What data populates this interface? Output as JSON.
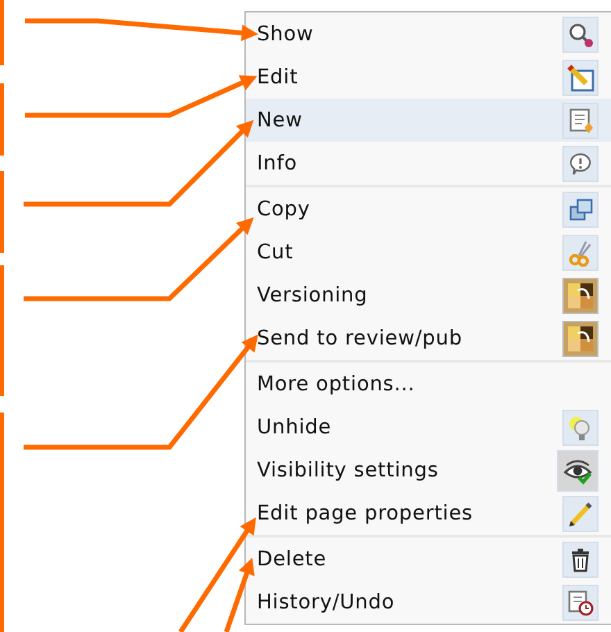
{
  "context_menu": {
    "groups": [
      {
        "items": [
          {
            "label": "Show",
            "selected": false
          },
          {
            "label": "Edit",
            "selected": false
          },
          {
            "label": "New",
            "selected": true
          },
          {
            "label": "Info",
            "selected": false
          }
        ]
      },
      {
        "items": [
          {
            "label": "Copy",
            "selected": false
          },
          {
            "label": "Cut",
            "selected": false
          },
          {
            "label": "Versioning",
            "selected": false
          },
          {
            "label": "Send to review/pub",
            "selected": false
          }
        ]
      },
      {
        "items": [
          {
            "label": "More options...",
            "selected": false
          },
          {
            "label": "Unhide",
            "selected": false
          },
          {
            "label": "Visibility settings",
            "selected": false
          },
          {
            "label": "Edit page properties",
            "selected": false
          }
        ]
      },
      {
        "items": [
          {
            "label": "Delete",
            "selected": false
          },
          {
            "label": "History/Undo",
            "selected": false
          }
        ]
      }
    ]
  }
}
